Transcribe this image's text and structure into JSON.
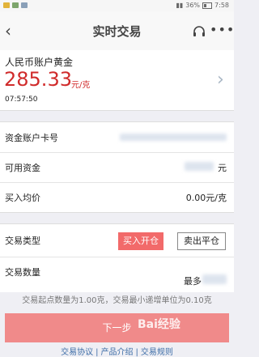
{
  "status_bar": {
    "battery": "36%",
    "time": "7:58"
  },
  "nav": {
    "title": "实时交易",
    "back_icon": "chevron-left-icon",
    "service_icon": "headset-icon",
    "more": "•••"
  },
  "product": {
    "name": "人民币账户黄金",
    "price": "285.33",
    "unit": "元/克",
    "time": "07:57:50"
  },
  "account": {
    "card_label": "资金账户卡号",
    "available_label": "可用资金",
    "available_suffix": "元",
    "avg_label": "买入均价",
    "avg_value": "0.00元/克"
  },
  "trade": {
    "type_label": "交易类型",
    "buy_label": "买入开仓",
    "sell_label": "卖出平仓",
    "qty_label": "交易数量",
    "qty_max_prefix": "最多"
  },
  "hint": "交易起点数量为1.00克，交易最小递增单位为0.10克",
  "next_label": "下一步",
  "watermark": "Bai经验",
  "links": [
    "交易协议",
    "产品介绍",
    "交易规则"
  ],
  "colors": {
    "price_red": "#d02b2b",
    "buy_button": "#f26a6a",
    "next_button": "#f08a8a",
    "link_blue": "#3e6ea8"
  }
}
